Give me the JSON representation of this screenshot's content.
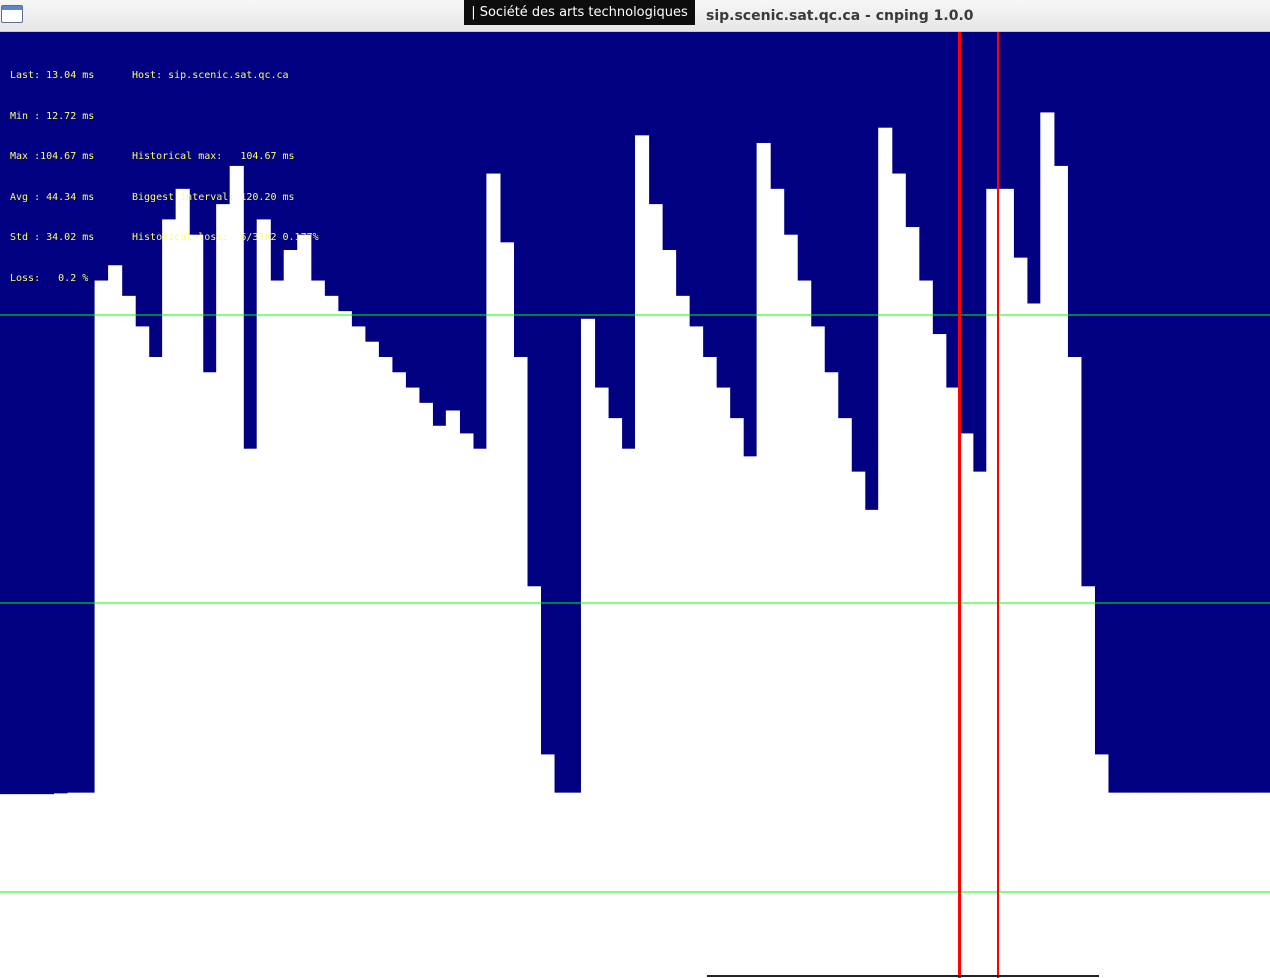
{
  "window": {
    "title": "sip.scenic.sat.qc.ca - cnping 1.0.0",
    "tooltip": "| Société des arts technologiques"
  },
  "stats": {
    "last": "Last: 13.04 ms",
    "min": "Min : 12.72 ms",
    "max": "Max :104.67 ms",
    "avg": "Avg : 44.34 ms",
    "std": "Std : 34.02 ms",
    "loss": "Loss:   0.2 %",
    "host": "Host: sip.scenic.sat.qc.ca",
    "historical_max": "Historical max:   104.67 ms",
    "biggest_interval": "Biggest interval: 120.20 ms",
    "historical_loss": "Historical loss:  6/3382 0.177%"
  },
  "colors": {
    "background": "#000080",
    "samples": "#ffffff",
    "gridlines": "#00ff00",
    "loss_markers": "#ff0000",
    "stats_text": "#ffff66"
  },
  "chart_data": {
    "type": "area",
    "unit": "ms",
    "y_range_ms": [
      0,
      104.67
    ],
    "gridlines": true,
    "series": [
      {
        "values_ms": [
          12.8,
          12.8,
          12.8,
          12.8,
          12.9,
          13.0,
          13.0,
          80.0,
          82.0,
          78.0,
          74.0,
          70.0,
          88.0,
          92.0,
          86.0,
          68.0,
          90.0,
          95.0,
          58.0,
          88.0,
          80.0,
          84.0,
          86.0,
          80.0,
          78.0,
          76.0,
          74.0,
          72.0,
          70.0,
          68.0,
          66.0,
          64.0,
          61.0,
          63.0,
          60.0,
          58.0,
          94.0,
          85.0,
          70.0,
          40.0,
          18.0,
          13.0,
          13.0,
          75.0,
          66.0,
          62.0,
          58.0,
          99.0,
          90.0,
          84.0,
          78.0,
          74.0,
          70.0,
          66.0,
          62.0,
          57.0,
          98.0,
          92.0,
          86.0,
          80.0,
          74.0,
          68.0,
          62.0,
          55.0,
          50.0,
          100.0,
          94.0,
          87.0,
          80.0,
          73.0,
          66.0,
          60.0,
          55.0,
          92.0,
          92.0,
          83.0,
          77.0,
          102.0,
          95.0,
          70.0,
          40.0,
          18.0,
          13.0,
          13.0,
          13.0,
          13.0,
          13.0,
          13.0,
          13.0,
          13.0,
          13.0,
          13.0,
          13.0,
          13.0
        ]
      }
    ]
  }
}
